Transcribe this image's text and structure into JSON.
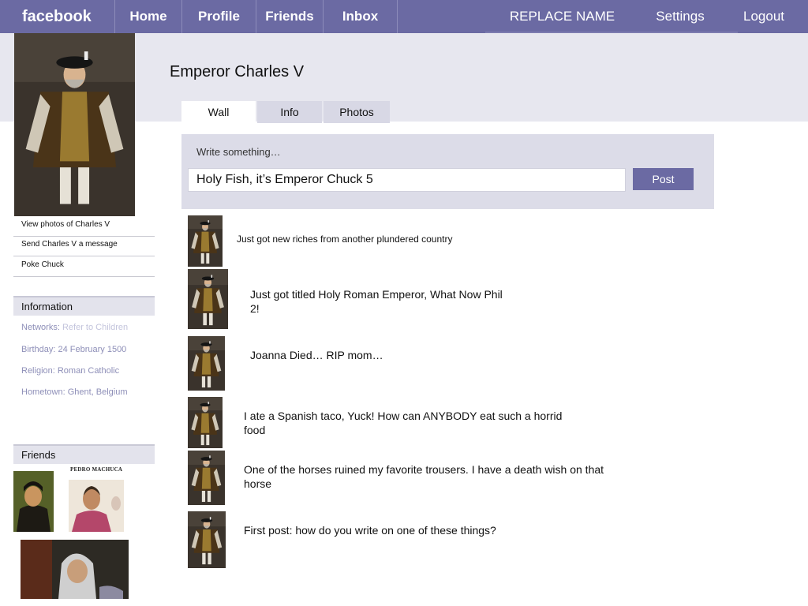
{
  "nav": {
    "logo": "facebook",
    "home": "Home",
    "profile": "Profile",
    "friends": "Friends",
    "inbox": "Inbox",
    "user_name": "REPLACE NAME",
    "settings": "Settings",
    "logout": "Logout"
  },
  "profile": {
    "name": "Emperor Charles V"
  },
  "tabs": {
    "wall": "Wall",
    "info": "Info",
    "photos": "Photos"
  },
  "actions": {
    "view_photos": "View photos of Charles V",
    "send_message": "Send  Charles V a message",
    "poke": "Poke Chuck"
  },
  "information": {
    "header": "Information",
    "networks_label": "Networks",
    "networks_value": "Refer to Children",
    "birthday": "Birthday: 24 February 1500",
    "religion": "Religion: Roman Catholic",
    "hometown": "Hometown: Ghent,  Belgium"
  },
  "friends": {
    "header": "Friends",
    "caption": "PEDRO MACHUCA"
  },
  "composer": {
    "label": "Write something…",
    "value": "Holy Fish, it’s Emperor Chuck 5",
    "post_button": "Post"
  },
  "posts": [
    {
      "text": "Just got new riches from another plundered country"
    },
    {
      "text": "Just got titled Holy Roman Emperor, What Now Phil 2!"
    },
    {
      "text": "Joanna Died… RIP mom…"
    },
    {
      "text": "I ate a Spanish taco, Yuck! How can ANYBODY eat such a horrid food"
    },
    {
      "text": "One of the horses ruined my favorite trousers. I have a death wish on that horse"
    },
    {
      "text": "First post: how do you write on one of these things?"
    }
  ],
  "colors": {
    "brand": "#6b6aa3",
    "header_band": "#e7e7ef",
    "composer_bg": "#dcdce8",
    "info_text": "#8e8fb8"
  }
}
